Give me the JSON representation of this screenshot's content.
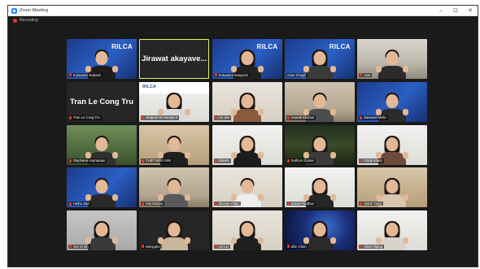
{
  "window": {
    "title": "Zoom Meeting",
    "minimize": "–",
    "maximize": "⊡",
    "close": "✕"
  },
  "recording": {
    "label": "Recording"
  },
  "tiles": [
    {
      "name": "Kulwadee Rubasit",
      "bg": "bg-blue",
      "banner": "RILCA",
      "hair": "short",
      "shirt": "#1d1d1d",
      "muted": true
    },
    {
      "name": "Jirawat akayavee",
      "bg": "name",
      "display": "Jirawat  akayave...",
      "active": true
    },
    {
      "name": "Kulwadee Buaprom",
      "bg": "bg-blue",
      "banner": "RILCA",
      "hair": "long",
      "shirt": "#222222",
      "muted": true
    },
    {
      "name": "Aitan Khaipli",
      "bg": "bg-blue",
      "banner": "RILCA",
      "hair": "long",
      "shirt": "#3a3a3a",
      "muted": false
    },
    {
      "name": "Aine",
      "bg": "bg-office",
      "hair": "short",
      "shirt": "#2c2c2c",
      "muted": true
    },
    {
      "name": "Tran Le Cong Tru",
      "bg": "name",
      "display": "Tran Le Cong Tru",
      "muted": true
    },
    {
      "name": "Jiraporn Dr Suraya S",
      "bg": "bg-white",
      "banner": "RILCA",
      "bannerDark": true,
      "hair": "long",
      "shirt": "#d9d9d9",
      "muted": true
    },
    {
      "name": "Lin Jan",
      "bg": "bg-wall",
      "hair": "long",
      "shirt": "#8b5a3c",
      "muted": true
    },
    {
      "name": "Anurak Ekchan",
      "bg": "bg-room",
      "hair": "short",
      "shirt": "#4d4d4d",
      "muted": true
    },
    {
      "name": "Sanward Mello",
      "bg": "bg-blue",
      "hair": "short",
      "shirt": "#2b2b2b",
      "muted": true
    },
    {
      "name": "Stephanie Sumaraan",
      "bg": "bg-green",
      "hair": "short",
      "shirt": "#2f2f2f",
      "muted": true
    },
    {
      "name": "THET MOO MIN",
      "bg": "bg-warm",
      "hair": "short",
      "shirt": "#1f1f1f",
      "muted": true
    },
    {
      "name": "Zoiksin",
      "bg": "bg-white",
      "hair": "long",
      "shirt": "#1c1c1c",
      "muted": true
    },
    {
      "name": "Kathryn Dunne",
      "bg": "bg-forest",
      "hair": "long",
      "shirt": "#3b3b3b",
      "muted": true
    },
    {
      "name": "Cindy Khatri",
      "bg": "bg-white",
      "hair": "long",
      "shirt": "#6d4b3b",
      "muted": true
    },
    {
      "name": "Hathu Sari",
      "bg": "bg-blue",
      "hair": "short",
      "shirt": "#2a2a2a",
      "muted": true
    },
    {
      "name": "Mai Mohan",
      "bg": "bg-room",
      "hair": "short",
      "shirt": "#5a5a5a",
      "muted": true
    },
    {
      "name": "Zhenye Chen",
      "bg": "bg-wall",
      "hair": "short",
      "shirt": "#ededed",
      "muted": true
    },
    {
      "name": "Sarah Pradhan",
      "bg": "bg-white",
      "hair": "long",
      "shirt": "#262626",
      "muted": true
    },
    {
      "name": "Yalcin Yang",
      "bg": "bg-warm",
      "hair": "long",
      "shirt": "#d9c7b0",
      "muted": true
    },
    {
      "name": "Yev Si Zin",
      "bg": "bg-grey",
      "hair": "long",
      "shirt": "#3a3a3a",
      "muted": true
    },
    {
      "name": "Menguhe",
      "bg": "bg-dark",
      "hair": "long",
      "shirt": "#c9b79b",
      "muted": true
    },
    {
      "name": "Lin Lin",
      "bg": "bg-wall",
      "hair": "long",
      "shirt": "#1f1f1f",
      "muted": true
    },
    {
      "name": "Zilin Chen",
      "bg": "bg-space",
      "hair": "long",
      "shirt": "#2a2a2a",
      "muted": true
    },
    {
      "name": "Abeer Wang",
      "bg": "bg-white",
      "hair": "long",
      "shirt": "#d8d3c8",
      "muted": true
    }
  ]
}
